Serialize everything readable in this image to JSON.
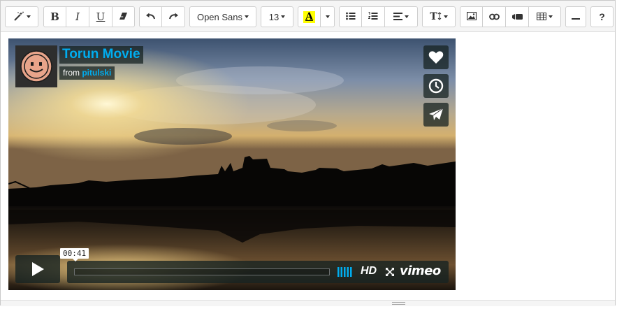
{
  "toolbar": {
    "font_name": "Open Sans",
    "font_size": "13",
    "bold_label": "B",
    "italic_label": "I",
    "underline_label": "U",
    "highlight_label": "A",
    "line_height_label": "T",
    "help_label": "?",
    "highlight_color": "#ffff00"
  },
  "video": {
    "title": "Torun Movie",
    "byline_prefix": "from",
    "byline_user": "pitulski",
    "timecode": "00:41",
    "hd_label": "HD",
    "brand": "vimeo",
    "accent_color": "#00adef"
  }
}
